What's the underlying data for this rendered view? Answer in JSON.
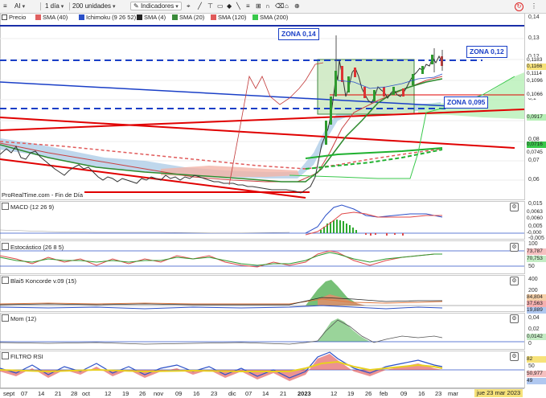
{
  "toolbar": {
    "symbol": "AI",
    "interval": "1 día",
    "units": "200 unidades",
    "indicators_label": "Indicadores"
  },
  "legend": [
    {
      "label": "Precio",
      "color": "#4a4a4a"
    },
    {
      "label": "SMA (40)",
      "color": "#e06060"
    },
    {
      "label": "Ichimoku (9 26 52)",
      "color": "#2b50c8"
    },
    {
      "label": "SMA (4)",
      "color": "#222222"
    },
    {
      "label": "SMA (20)",
      "color": "#3a8a3a"
    },
    {
      "label": "SMA (120)",
      "color": "#e05a5a"
    },
    {
      "label": "SMA (200)",
      "color": "#39c84b"
    }
  ],
  "annotations": {
    "zona_014": "ZONA 0,14",
    "zona_012": "ZONA 0,12",
    "zona_0095": "ZONA 0,095"
  },
  "source_label": "ProRealTime.com - Fin de Día",
  "price_axis": [
    "0,14",
    "0,13",
    "0,12",
    "0,11",
    "0,1",
    "0,09",
    "0,08",
    "0,07",
    "0,06"
  ],
  "price_tags": [
    "0,1183",
    "0,1166",
    "0,1114",
    "0,1096",
    "0,1066",
    "0,0917",
    "0,0716",
    "0,0745"
  ],
  "panels": [
    {
      "key": "macd",
      "label": "MACD (12 26 9)",
      "axis": [
        "0,015",
        "0,01",
        "0,005",
        "0",
        "-0,005"
      ],
      "tags": [
        "0,0063",
        "0,0060",
        "-0,000"
      ]
    },
    {
      "key": "estocastico",
      "label": "Estocástico (26 8 5)",
      "axis": [
        "100",
        "50"
      ],
      "tags": [
        "73,787",
        "70,753"
      ]
    },
    {
      "key": "koncorde",
      "label": "Blai5 Koncorde v.09 (15)",
      "axis": [
        "400",
        "200",
        "0"
      ],
      "tags": [
        "84,804",
        "37,563",
        "19,889"
      ]
    },
    {
      "key": "mom",
      "label": "Mom (12)",
      "axis": [
        "0,04",
        "0,02",
        "0"
      ],
      "tags": [
        "0,0142"
      ]
    },
    {
      "key": "rsi",
      "label": "FILTRO RSI",
      "axis": [
        "50"
      ],
      "tags": [
        "82",
        "50,977",
        "49"
      ]
    }
  ],
  "time_axis": [
    "sept",
    "07",
    "14",
    "21",
    "28",
    "oct",
    "12",
    "19",
    "26",
    "nov",
    "09",
    "16",
    "23",
    "dic",
    "07",
    "14",
    "21",
    "2023",
    "12",
    "19",
    "26",
    "feb",
    "09",
    "16",
    "23",
    "mar",
    "09",
    "16"
  ],
  "date_marker": "jue 23 mar 2023"
}
